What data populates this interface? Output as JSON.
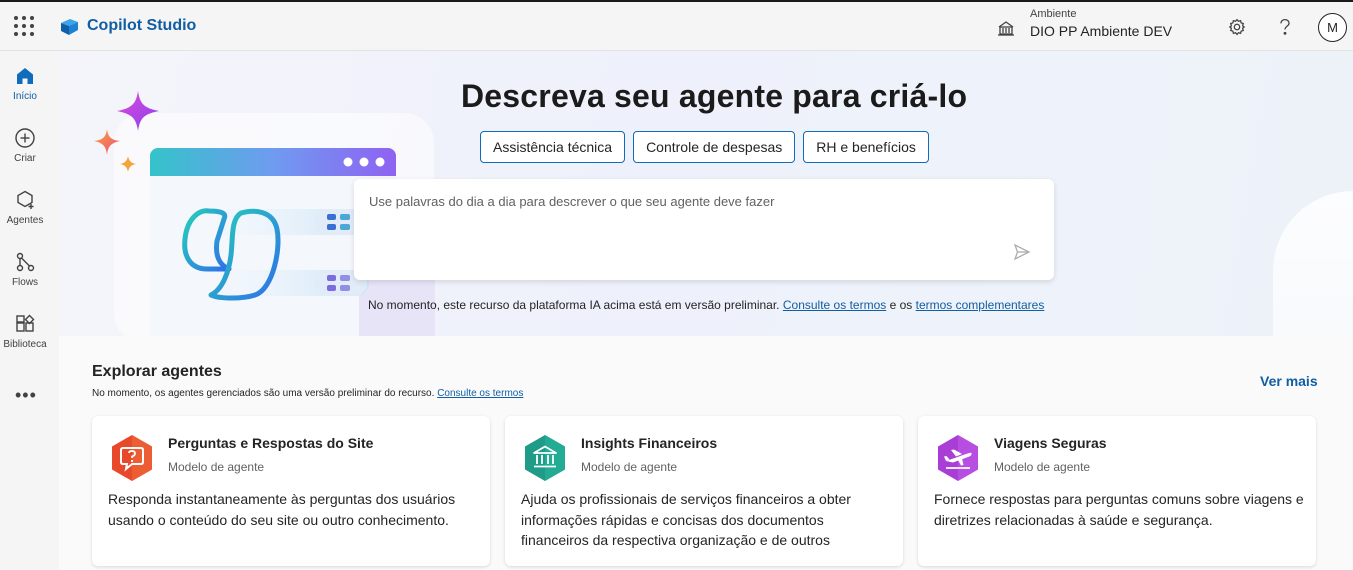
{
  "header": {
    "app_name": "Copilot Studio",
    "environment_label": "Ambiente",
    "environment_name": "DIO PP Ambiente DEV",
    "avatar_initial": "M"
  },
  "nav": {
    "items": [
      {
        "label": "Início",
        "icon": "home-icon",
        "active": true
      },
      {
        "label": "Criar",
        "icon": "add-circle-icon"
      },
      {
        "label": "Agentes",
        "icon": "agents-icon"
      },
      {
        "label": "Flows",
        "icon": "flows-icon"
      },
      {
        "label": "Biblioteca",
        "icon": "library-icon"
      }
    ],
    "more": "•••"
  },
  "hero": {
    "title": "Descreva seu agente para criá-lo",
    "chips": [
      "Assistência técnica",
      "Controle de despesas",
      "RH e benefícios"
    ],
    "prompt_placeholder": "Use palavras do dia a dia para descrever o que seu agente deve fazer",
    "disclaimer_text": "No momento, este recurso da plataforma IA acima está em versão preliminar.",
    "disclaimer_link1": "Consulte os termos",
    "disclaimer_and": "e os",
    "disclaimer_link2": "termos complementares"
  },
  "explore": {
    "title": "Explorar agentes",
    "subtitle": "No momento, os agentes gerenciados são uma versão preliminar do recurso.",
    "subtitle_link": "Consulte os termos",
    "see_more": "Ver mais",
    "cards": [
      {
        "title": "Perguntas e Respostas do Site",
        "type": "Modelo de agente",
        "description": "Responda instantaneamente às perguntas dos usuários usando o conteúdo do seu site ou outro conhecimento.",
        "icon": "question-chat-icon",
        "color": "#e8492b"
      },
      {
        "title": "Insights Financeiros",
        "type": "Modelo de agente",
        "description": "Ajuda os profissionais de serviços financeiros a obter informações rápidas e concisas dos documentos financeiros da respectiva organização e de outros recurso...",
        "icon": "bank-icon",
        "color": "#1f9b88"
      },
      {
        "title": "Viagens Seguras",
        "type": "Modelo de agente",
        "description": "Fornece respostas para perguntas comuns sobre viagens e diretrizes relacionadas à saúde e segurança.",
        "icon": "airplane-icon",
        "color": "#a93ed6"
      }
    ]
  },
  "colors": {
    "accent": "#115ea3",
    "chip_border": "#0f6cbd"
  }
}
